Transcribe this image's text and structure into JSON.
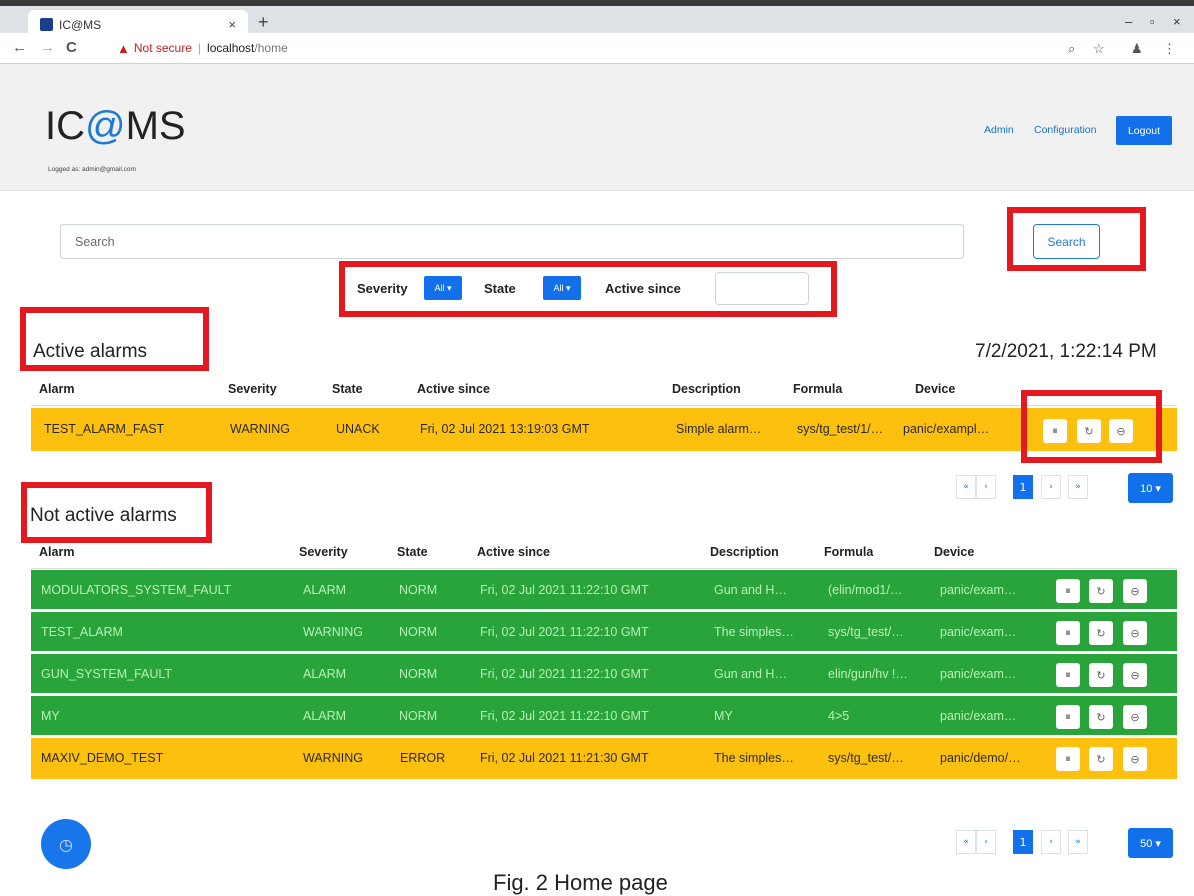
{
  "browser": {
    "tab_title": "IC@MS",
    "tab_close": "×",
    "new_tab": "+",
    "win_minimize": "–",
    "win_maximize": "▫",
    "win_close": "×",
    "back": "←",
    "forward": "→",
    "reload": "C",
    "not_secure": "Not secure",
    "separator": "|",
    "url_host": "localhost",
    "url_path": "/home"
  },
  "header": {
    "logo_left": "IC",
    "logo_at": "@",
    "logo_right": "MS",
    "logged_as": "Logged as: admin@gmail.com",
    "admin_link": "Admin",
    "config_link": "Configuration",
    "logout": "Logout"
  },
  "search": {
    "placeholder": "Search",
    "button": "Search"
  },
  "filters": {
    "severity_label": "Severity",
    "severity_value": "All ▾",
    "state_label": "State",
    "state_value": "All ▾",
    "active_since_label": "Active since"
  },
  "active": {
    "title": "Active alarms",
    "timestamp": "7/2/2021, 1:22:14 PM",
    "columns": [
      "Alarm",
      "Severity",
      "State",
      "Active since",
      "Description",
      "Formula",
      "Device"
    ],
    "rows": [
      {
        "alarm": "TEST_ALARM_FAST",
        "severity": "WARNING",
        "state": "UNACK",
        "since": "Fri, 02 Jul 2021 13:19:03 GMT",
        "desc": "Simple alarm…",
        "formula": "sys/tg_test/1/…",
        "device": "panic/exampl…",
        "color": "#fdc00f"
      }
    ],
    "pagination": {
      "first": "«",
      "prev": "‹",
      "page": "1",
      "next": "›",
      "last": "»",
      "per_page": "10 ▾"
    }
  },
  "inactive": {
    "title": "Not active alarms",
    "columns": [
      "Alarm",
      "Severity",
      "State",
      "Active since",
      "Description",
      "Formula",
      "Device"
    ],
    "rows": [
      {
        "alarm": "MODULATORS_SYSTEM_FAULT",
        "severity": "ALARM",
        "state": "NORM",
        "since": "Fri, 02 Jul 2021 11:22:10 GMT",
        "desc": "Gun and H…",
        "formula": "(elin/mod1/…",
        "device": "panic/exam…",
        "color": "#29a43b"
      },
      {
        "alarm": "TEST_ALARM",
        "severity": "WARNING",
        "state": "NORM",
        "since": "Fri, 02 Jul 2021 11:22:10 GMT",
        "desc": "The simples…",
        "formula": "sys/tg_test/…",
        "device": "panic/exam…",
        "color": "#29a43b"
      },
      {
        "alarm": "GUN_SYSTEM_FAULT",
        "severity": "ALARM",
        "state": "NORM",
        "since": "Fri, 02 Jul 2021 11:22:10 GMT",
        "desc": "Gun and H…",
        "formula": "elin/gun/hv !…",
        "device": "panic/exam…",
        "color": "#29a43b"
      },
      {
        "alarm": "MY",
        "severity": "ALARM",
        "state": "NORM",
        "since": "Fri, 02 Jul 2021 11:22:10 GMT",
        "desc": "MY",
        "formula": "4>5",
        "device": "panic/exam…",
        "color": "#29a43b"
      },
      {
        "alarm": "MAXIV_DEMO_TEST",
        "severity": "WARNING",
        "state": "ERROR",
        "since": "Fri, 02 Jul 2021 11:21:30 GMT",
        "desc": "The simples…",
        "formula": "sys/tg_test/…",
        "device": "panic/demo/…",
        "color": "#fdc00f"
      }
    ],
    "pagination": {
      "first": "«",
      "prev": "‹",
      "page": "1",
      "next": "›",
      "last": "»",
      "per_page": "50 ▾"
    }
  },
  "icons": {
    "shelve": "⏸",
    "reset": "↻",
    "disable": "⊖",
    "history": "◷",
    "warning": "▲",
    "zoom": "⌕",
    "star": "☆",
    "profile": "♟",
    "menu": "⋮"
  },
  "caption": "Fig. 2 Home page"
}
